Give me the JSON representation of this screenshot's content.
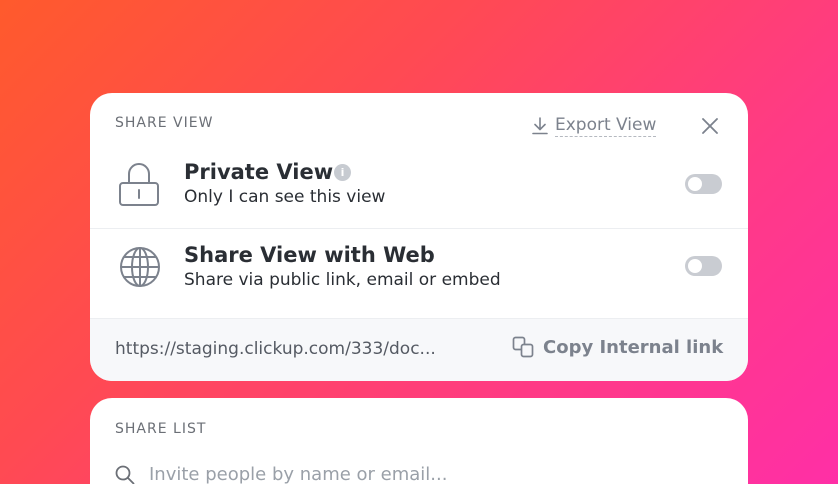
{
  "share_view": {
    "section_label": "SHARE VIEW",
    "export_label": "Export View",
    "private": {
      "title": "Private View",
      "subtitle": "Only I can see this view",
      "enabled": false
    },
    "web": {
      "title": "Share View with Web",
      "subtitle": "Share via public link, email or embed",
      "enabled": false
    },
    "link_url": "https://staging.clickup.com/333/doc...",
    "copy_label": "Copy Internal link"
  },
  "share_list": {
    "section_label": "SHARE LIST",
    "search_placeholder": "Invite people by name or email..."
  },
  "icons": {
    "export": "download-icon",
    "close": "close-icon",
    "private": "lock-icon",
    "info": "info-icon",
    "web": "globe-icon",
    "copy": "copy-icon",
    "search": "search-icon"
  },
  "colors": {
    "gradient_start": "#ff5a2c",
    "gradient_end": "#ff2fa6",
    "card": "#ffffff",
    "text": "#2a2e34",
    "muted": "#7c828d",
    "toggle_off": "#c9ccd2"
  }
}
